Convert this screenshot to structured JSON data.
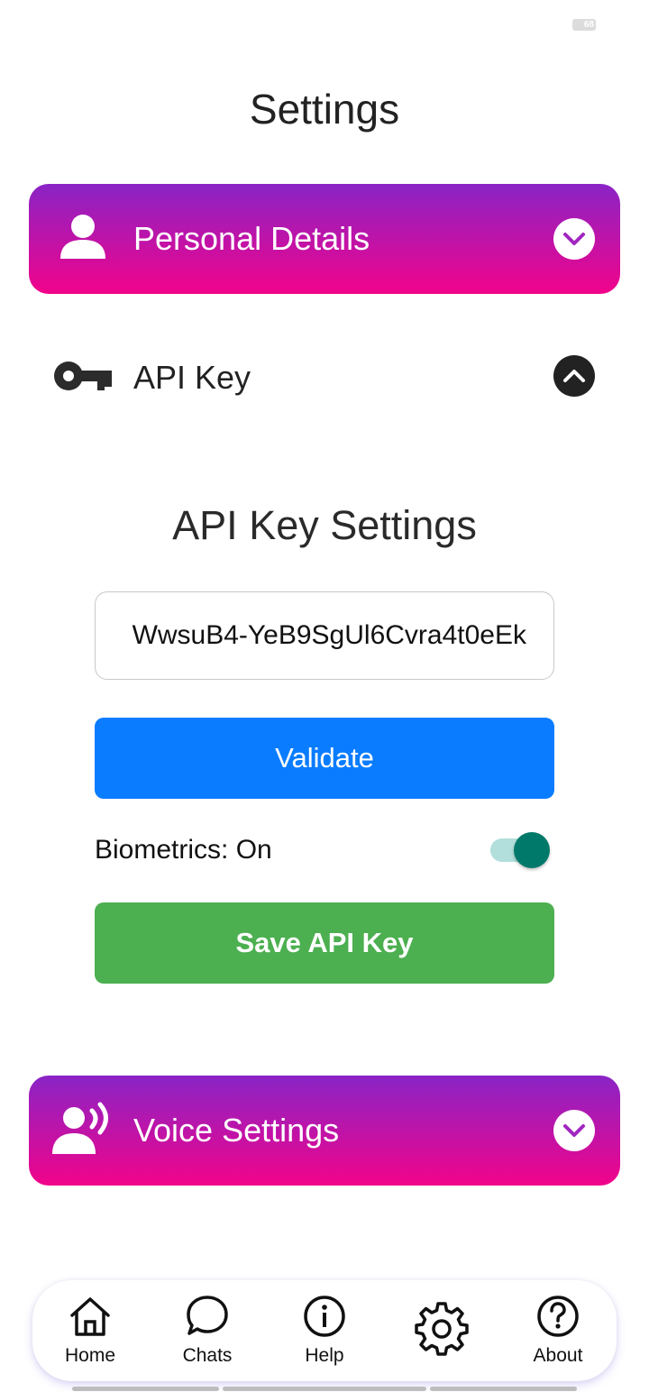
{
  "status": {
    "battery": "68"
  },
  "page": {
    "title": "Settings"
  },
  "personal_details": {
    "label": "Personal Details",
    "icon": "person-icon"
  },
  "api_key": {
    "label": "API Key",
    "icon": "key-icon",
    "expanded": true
  },
  "api_settings": {
    "title": "API Key Settings",
    "input_value": "WwsuB4-YeB9SgUl6Cvra4t0eEk",
    "validate_label": "Validate",
    "biometrics_label": "Biometrics: On",
    "biometrics_on": true,
    "save_label": "Save API Key"
  },
  "voice_settings": {
    "label": "Voice Settings",
    "icon": "voice-icon"
  },
  "nav": {
    "items": [
      {
        "label": "Home",
        "icon": "home-icon"
      },
      {
        "label": "Chats",
        "icon": "chat-icon"
      },
      {
        "label": "Help",
        "icon": "info-icon"
      },
      {
        "label": "",
        "icon": "gear-icon"
      },
      {
        "label": "About",
        "icon": "question-icon"
      }
    ]
  },
  "colors": {
    "gradient_top": "#8a24c6",
    "gradient_bottom": "#f2038a",
    "validate": "#0a7cff",
    "save": "#4caf50",
    "toggle_on": "#00796b"
  }
}
